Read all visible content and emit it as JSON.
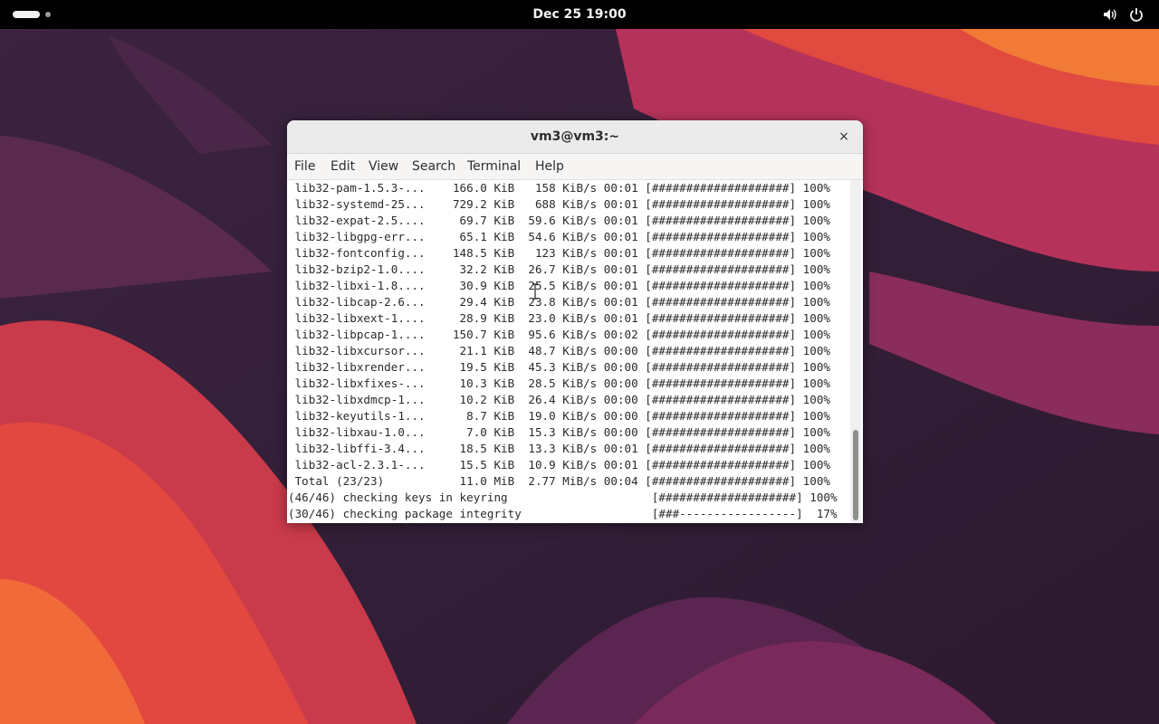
{
  "topbar": {
    "clock": "Dec 25  19:00",
    "activities_icon": "activities-pill-icon",
    "volume_icon": "speaker-icon",
    "power_icon": "power-icon"
  },
  "window": {
    "title": "vm3@vm3:~",
    "close_label": "×",
    "menu": [
      "File",
      "Edit",
      "View",
      "Search",
      "Terminal",
      "Help"
    ]
  },
  "terminal_lines": [
    " lib32-pam-1.5.3-...    166.0 KiB   158 KiB/s 00:01 [####################] 100%",
    " lib32-systemd-25...    729.2 KiB   688 KiB/s 00:01 [####################] 100%",
    " lib32-expat-2.5....     69.7 KiB  59.6 KiB/s 00:01 [####################] 100%",
    " lib32-libgpg-err...     65.1 KiB  54.6 KiB/s 00:01 [####################] 100%",
    " lib32-fontconfig...    148.5 KiB   123 KiB/s 00:01 [####################] 100%",
    " lib32-bzip2-1.0....     32.2 KiB  26.7 KiB/s 00:01 [####################] 100%",
    " lib32-libxi-1.8....     30.9 KiB  25.5 KiB/s 00:01 [####################] 100%",
    " lib32-libcap-2.6...     29.4 KiB  23.8 KiB/s 00:01 [####################] 100%",
    " lib32-libxext-1....     28.9 KiB  23.0 KiB/s 00:01 [####################] 100%",
    " lib32-libpcap-1....    150.7 KiB  95.6 KiB/s 00:02 [####################] 100%",
    " lib32-libxcursor...     21.1 KiB  48.7 KiB/s 00:00 [####################] 100%",
    " lib32-libxrender...     19.5 KiB  45.3 KiB/s 00:00 [####################] 100%",
    " lib32-libxfixes-...     10.3 KiB  28.5 KiB/s 00:00 [####################] 100%",
    " lib32-libxdmcp-1...     10.2 KiB  26.4 KiB/s 00:00 [####################] 100%",
    " lib32-keyutils-1...      8.7 KiB  19.0 KiB/s 00:00 [####################] 100%",
    " lib32-libxau-1.0...      7.0 KiB  15.3 KiB/s 00:00 [####################] 100%",
    " lib32-libffi-3.4...     18.5 KiB  13.3 KiB/s 00:01 [####################] 100%",
    " lib32-acl-2.3.1-...     15.5 KiB  10.9 KiB/s 00:01 [####################] 100%",
    " Total (23/23)           11.0 MiB  2.77 MiB/s 00:04 [####################] 100%",
    "(46/46) checking keys in keyring                     [####################] 100%",
    "(30/46) checking package integrity                   [###-----------------]  17%"
  ],
  "scrollbar": {
    "position_fraction": 1.0
  }
}
